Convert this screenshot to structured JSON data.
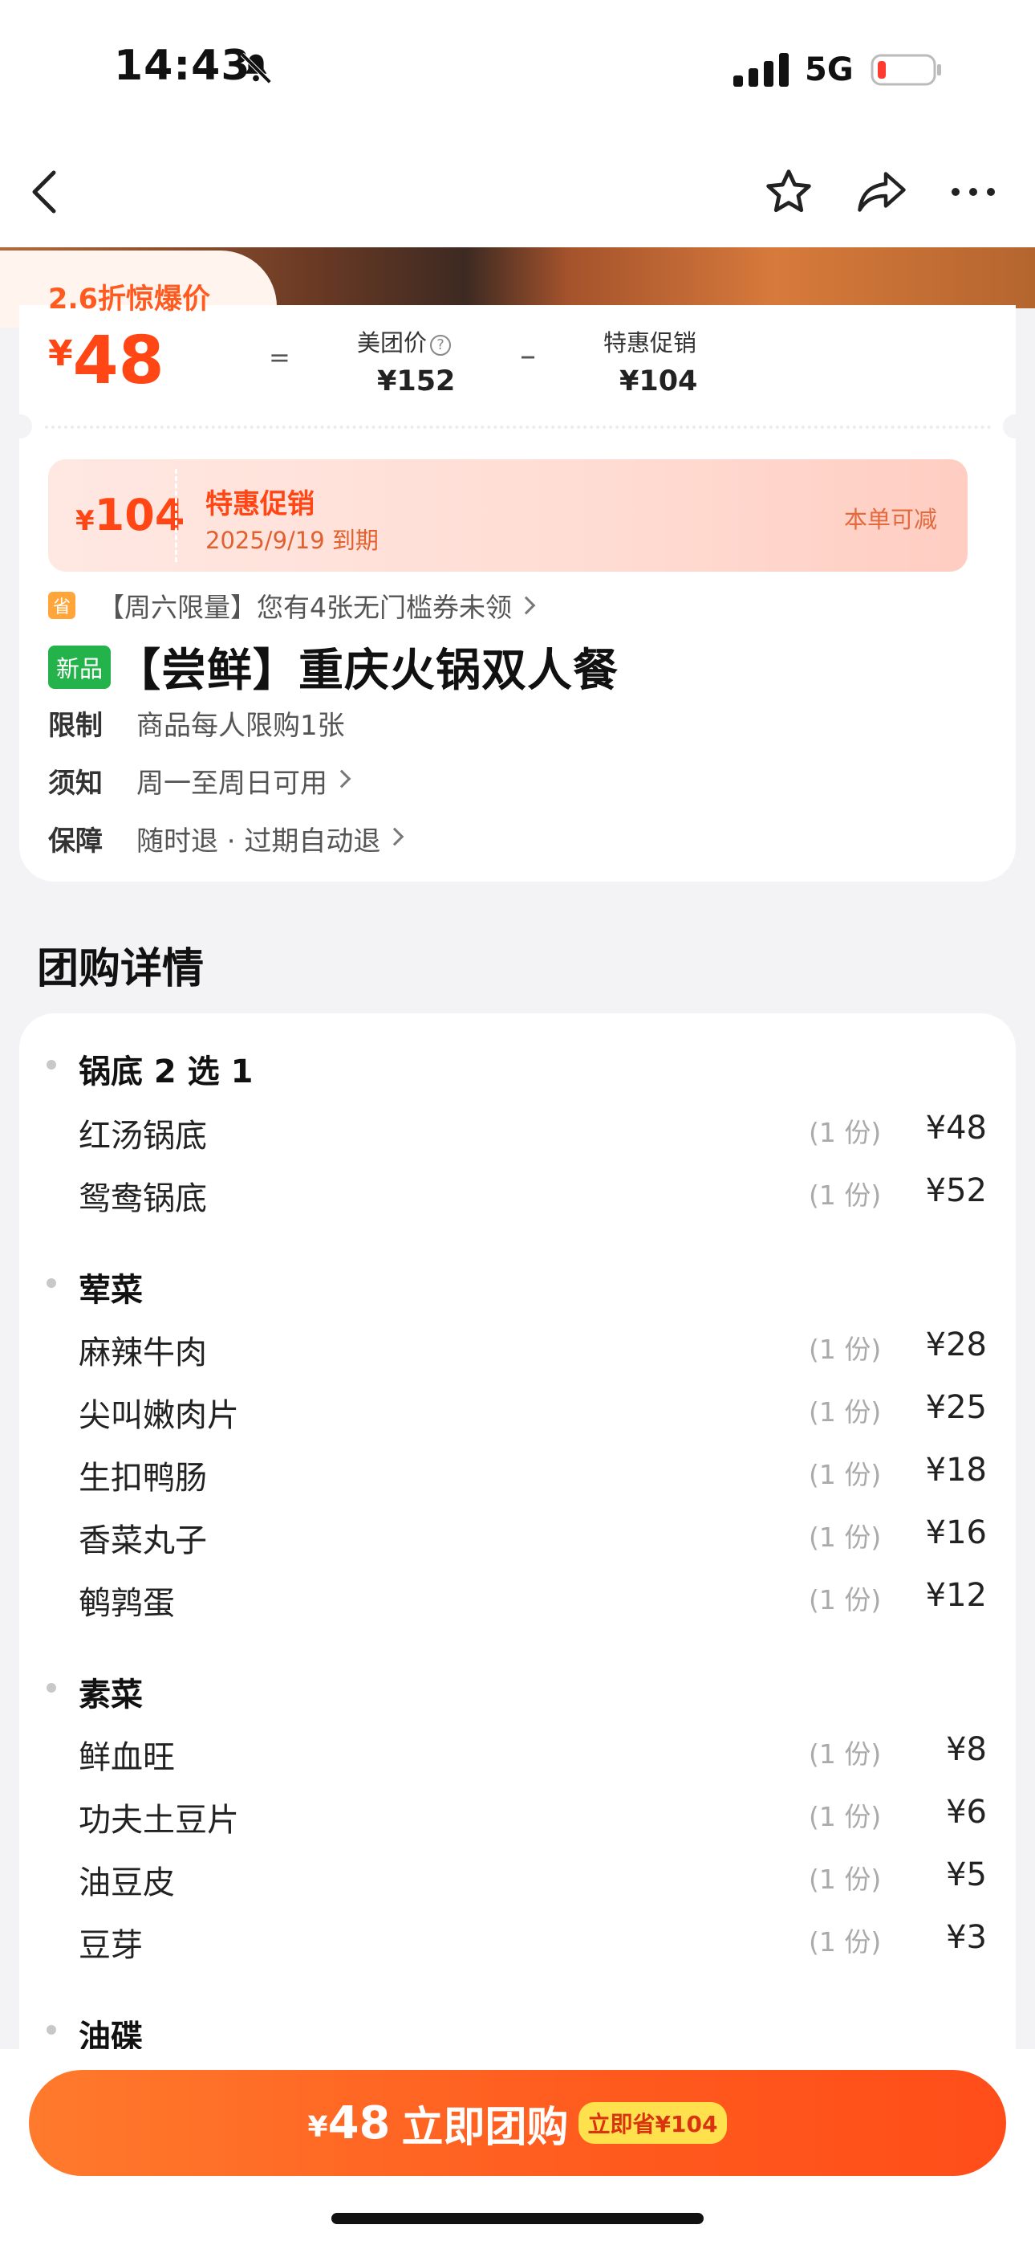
{
  "status": {
    "time": "14:43",
    "network": "5G"
  },
  "promo": {
    "discount_tag": "2.6折惊爆价",
    "currency": "¥",
    "deal_price": "48",
    "equals": "=",
    "minus": "–",
    "meituan_price_label": "美团价",
    "meituan_price": "¥152",
    "special_label": "特惠促销",
    "special_amount": "¥104"
  },
  "coupon": {
    "currency": "¥",
    "amount": "104",
    "title": "特惠促销",
    "expiry": "2025/9/19 到期",
    "applicable": "本单可减"
  },
  "saving_notice": {
    "icon_text": "省",
    "text": "【周六限量】您有4张无门槛券未领"
  },
  "product": {
    "badge": "新品",
    "title": "【尝鲜】重庆火锅双人餐"
  },
  "info_rows": [
    {
      "key": "限制",
      "value": "商品每人限购1张"
    },
    {
      "key": "须知",
      "value": "周一至周日可用"
    },
    {
      "key": "保障",
      "value": "随时退 · 过期自动退"
    }
  ],
  "details": {
    "section_title": "团购详情",
    "groups": [
      {
        "title": "锅底 2 选 1",
        "items": [
          {
            "name": "红汤锅底",
            "qty": "(1 份)",
            "price": "¥48"
          },
          {
            "name": "鸳鸯锅底",
            "qty": "(1 份)",
            "price": "¥52"
          }
        ]
      },
      {
        "title": "荤菜",
        "items": [
          {
            "name": "麻辣牛肉",
            "qty": "(1 份)",
            "price": "¥28"
          },
          {
            "name": "尖叫嫩肉片",
            "qty": "(1 份)",
            "price": "¥25"
          },
          {
            "name": "生扣鸭肠",
            "qty": "(1 份)",
            "price": "¥18"
          },
          {
            "name": "香菜丸子",
            "qty": "(1 份)",
            "price": "¥16"
          },
          {
            "name": "鹌鹑蛋",
            "qty": "(1 份)",
            "price": "¥12"
          }
        ]
      },
      {
        "title": "素菜",
        "items": [
          {
            "name": "鲜血旺",
            "qty": "(1 份)",
            "price": "¥8"
          },
          {
            "name": "功夫土豆片",
            "qty": "(1 份)",
            "price": "¥6"
          },
          {
            "name": "油豆皮",
            "qty": "(1 份)",
            "price": "¥5"
          },
          {
            "name": "豆芽",
            "qty": "(1 份)",
            "price": "¥3"
          }
        ]
      },
      {
        "title": "油碟",
        "items": []
      }
    ]
  },
  "buy_button": {
    "currency": "¥",
    "price": "48",
    "label": "立即团购",
    "save": "立即省¥104"
  },
  "colors": {
    "accent": "#ff4614",
    "new_badge": "#23b34a",
    "save_pill": "#ffe14d"
  }
}
